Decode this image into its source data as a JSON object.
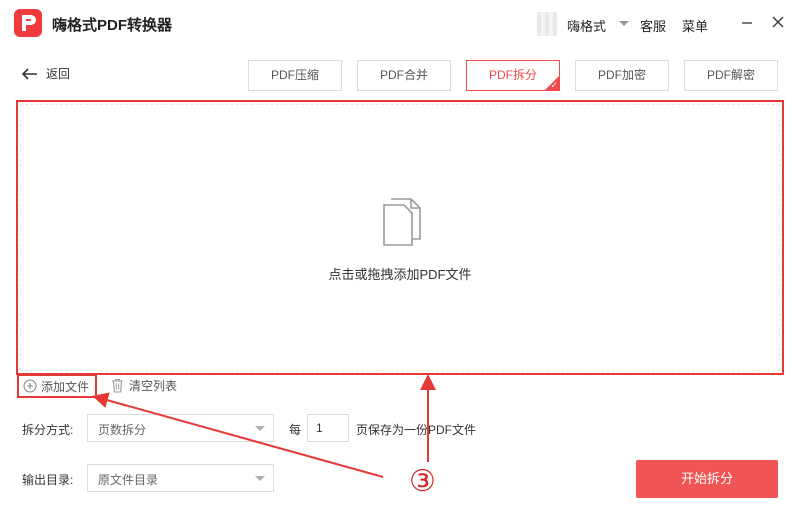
{
  "app": {
    "title": "嗨格式PDF转换器"
  },
  "header": {
    "user_name": "嗨格式",
    "menu": [
      "客服",
      "菜单"
    ],
    "icons": [
      "minimize-icon",
      "close-icon"
    ]
  },
  "nav": {
    "back_label": "返回"
  },
  "tabs": [
    {
      "label": "PDF压缩",
      "active": false
    },
    {
      "label": "PDF合并",
      "active": false
    },
    {
      "label": "PDF拆分",
      "active": true
    },
    {
      "label": "PDF加密",
      "active": false
    },
    {
      "label": "PDF解密",
      "active": false
    }
  ],
  "dropzone": {
    "text": "点击或拖拽添加PDF文件",
    "icon": "documents-icon"
  },
  "actions": {
    "add_file": "添加文件",
    "clear_list": "清空列表"
  },
  "split": {
    "label": "拆分方式:",
    "mode": "页数拆分",
    "every_label": "每",
    "pages": "1",
    "suffix": "页保存为一份PDF文件"
  },
  "output": {
    "label": "输出目录:",
    "dir": "原文件目录"
  },
  "start_button": "开始拆分",
  "annotation": {
    "step": "③"
  },
  "colors": {
    "accent": "#ef4b4b",
    "annotation": "#e53935"
  }
}
